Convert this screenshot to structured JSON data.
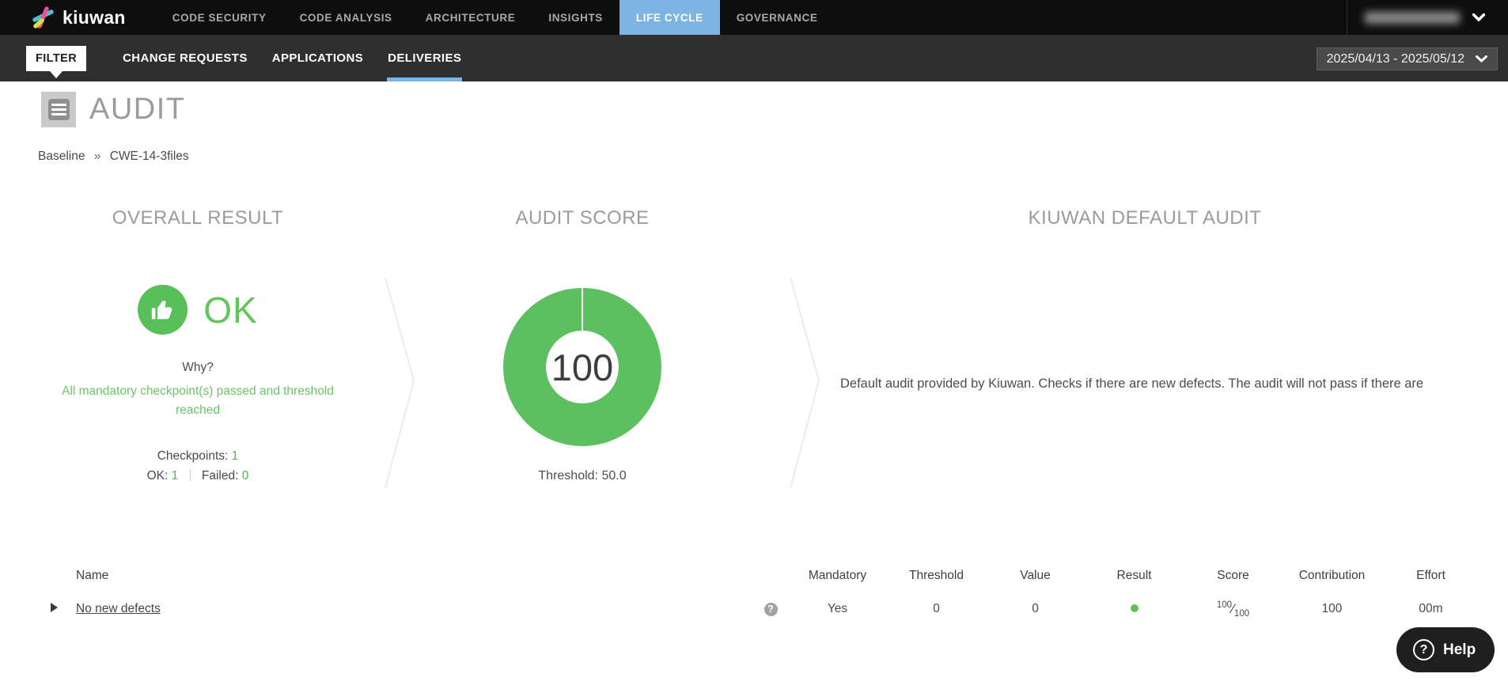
{
  "topnav": {
    "brand": "kiuwan",
    "items": [
      {
        "label": "CODE SECURITY"
      },
      {
        "label": "CODE ANALYSIS"
      },
      {
        "label": "ARCHITECTURE"
      },
      {
        "label": "INSIGHTS"
      },
      {
        "label": "LIFE CYCLE",
        "active": true
      },
      {
        "label": "GOVERNANCE"
      }
    ]
  },
  "subnav": {
    "filter_label": "FILTER",
    "tabs": [
      {
        "label": "CHANGE REQUESTS"
      },
      {
        "label": "APPLICATIONS"
      },
      {
        "label": "DELIVERIES",
        "active": true
      }
    ],
    "date_range": "2025/04/13 - 2025/05/12"
  },
  "page": {
    "title": "AUDIT",
    "breadcrumb": {
      "parent": "Baseline",
      "separator": "»",
      "current": "CWE-14-3files"
    }
  },
  "overall_result": {
    "heading": "OVERALL RESULT",
    "status": "OK",
    "why_label": "Why?",
    "reason": "All mandatory checkpoint(s) passed and threshold reached",
    "checkpoints_label": "Checkpoints:",
    "checkpoints_value": "1",
    "ok_label": "OK:",
    "ok_value": "1",
    "failed_label": "Failed:",
    "failed_value": "0"
  },
  "audit_score": {
    "heading": "AUDIT SCORE",
    "score": "100",
    "threshold_label": "Threshold:",
    "threshold_value": "50.0"
  },
  "default_audit": {
    "heading": "KIUWAN DEFAULT AUDIT",
    "description": "Default audit provided by Kiuwan. Checks if there are new defects. The audit will not pass if there are"
  },
  "checkpoints_table": {
    "headers": {
      "name": "Name",
      "mandatory": "Mandatory",
      "threshold": "Threshold",
      "value": "Value",
      "result": "Result",
      "score": "Score",
      "contribution": "Contribution",
      "effort": "Effort"
    },
    "rows": [
      {
        "name": "No new defects",
        "mandatory": "Yes",
        "threshold": "0",
        "value": "0",
        "result": "pass",
        "score_numerator": "100",
        "score_denominator": "100",
        "contribution": "100",
        "effort": "00m"
      }
    ]
  },
  "help": {
    "label": "Help"
  },
  "icons": {
    "brand_mark": "kiuwan-asterisk-icon",
    "user_chevron": "chevron-down-icon",
    "filter_caret": "caret-down-icon",
    "date_chevron": "chevron-down-icon",
    "audit_title": "list-lines-icon",
    "overall_status": "thumbs-up-icon",
    "section_separator": "chevron-right-line",
    "row_expand": "triangle-right-icon",
    "row_help": "question-circle-icon",
    "result_pass": "green-dot-icon",
    "help_button": "question-circle-icon"
  },
  "colors": {
    "accent_blue": "#7db4e3",
    "success_green": "#5cbf60",
    "topbar_bg": "#0e0e0e",
    "subbar_bg": "#2f2f2f"
  }
}
